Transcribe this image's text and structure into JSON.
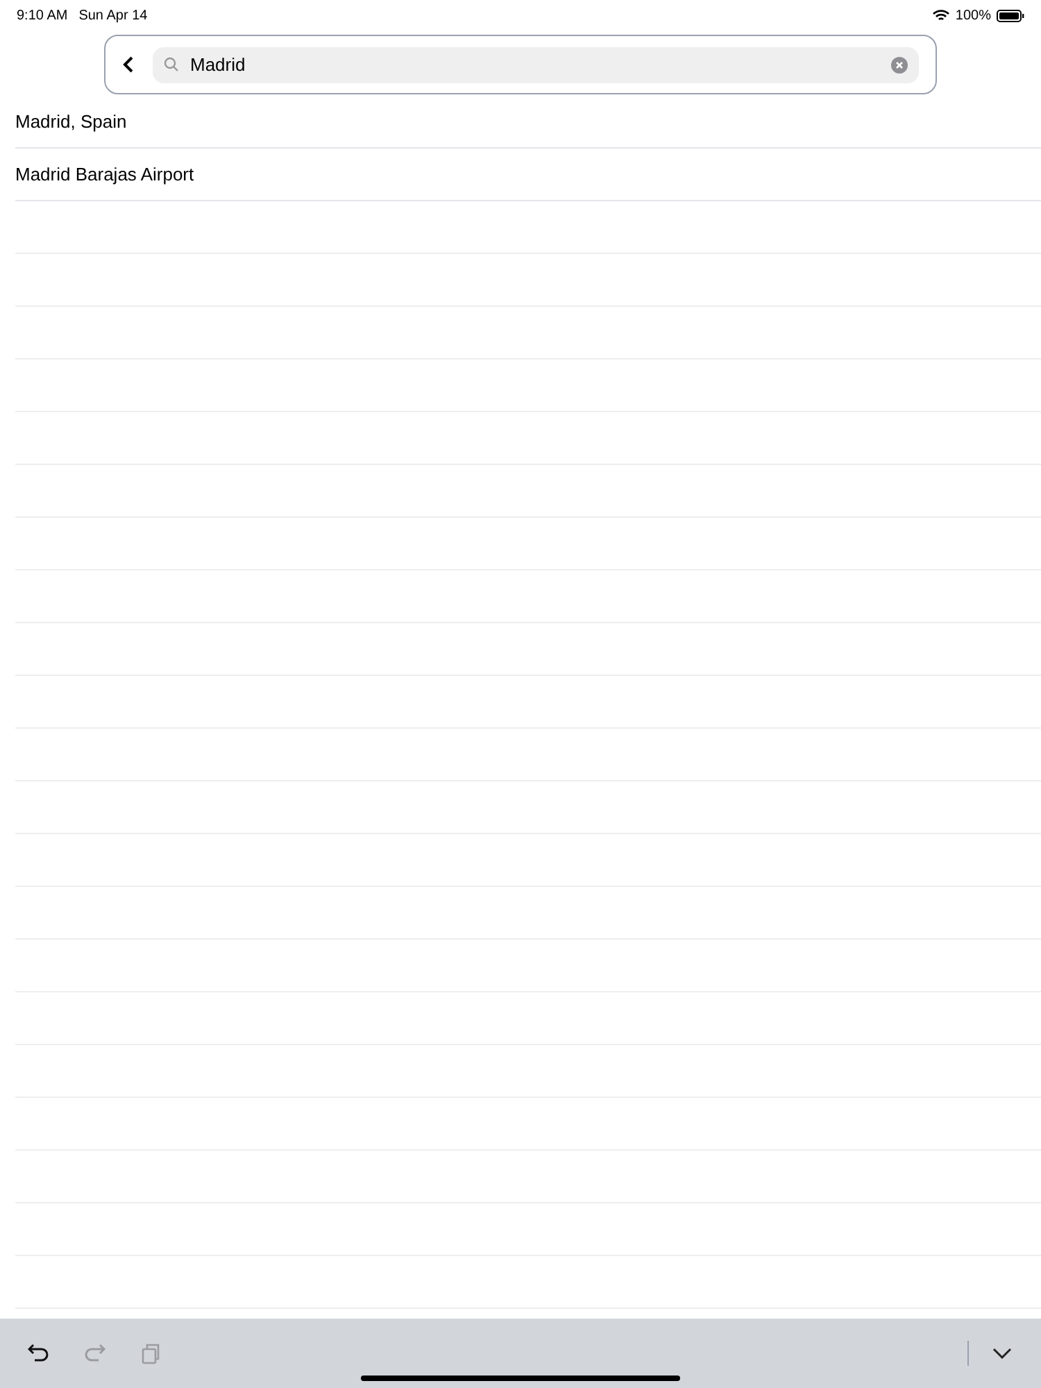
{
  "status_bar": {
    "time": "9:10 AM",
    "date": "Sun Apr 14",
    "battery": "100%"
  },
  "search": {
    "value": "Madrid"
  },
  "results": [
    "Madrid, Spain",
    "Madrid Barajas Airport"
  ],
  "toolbar": [
    {
      "kind": "undo",
      "disabled": false
    },
    {
      "kind": "redo",
      "disabled": true
    },
    {
      "kind": "paste",
      "disabled": true
    }
  ]
}
